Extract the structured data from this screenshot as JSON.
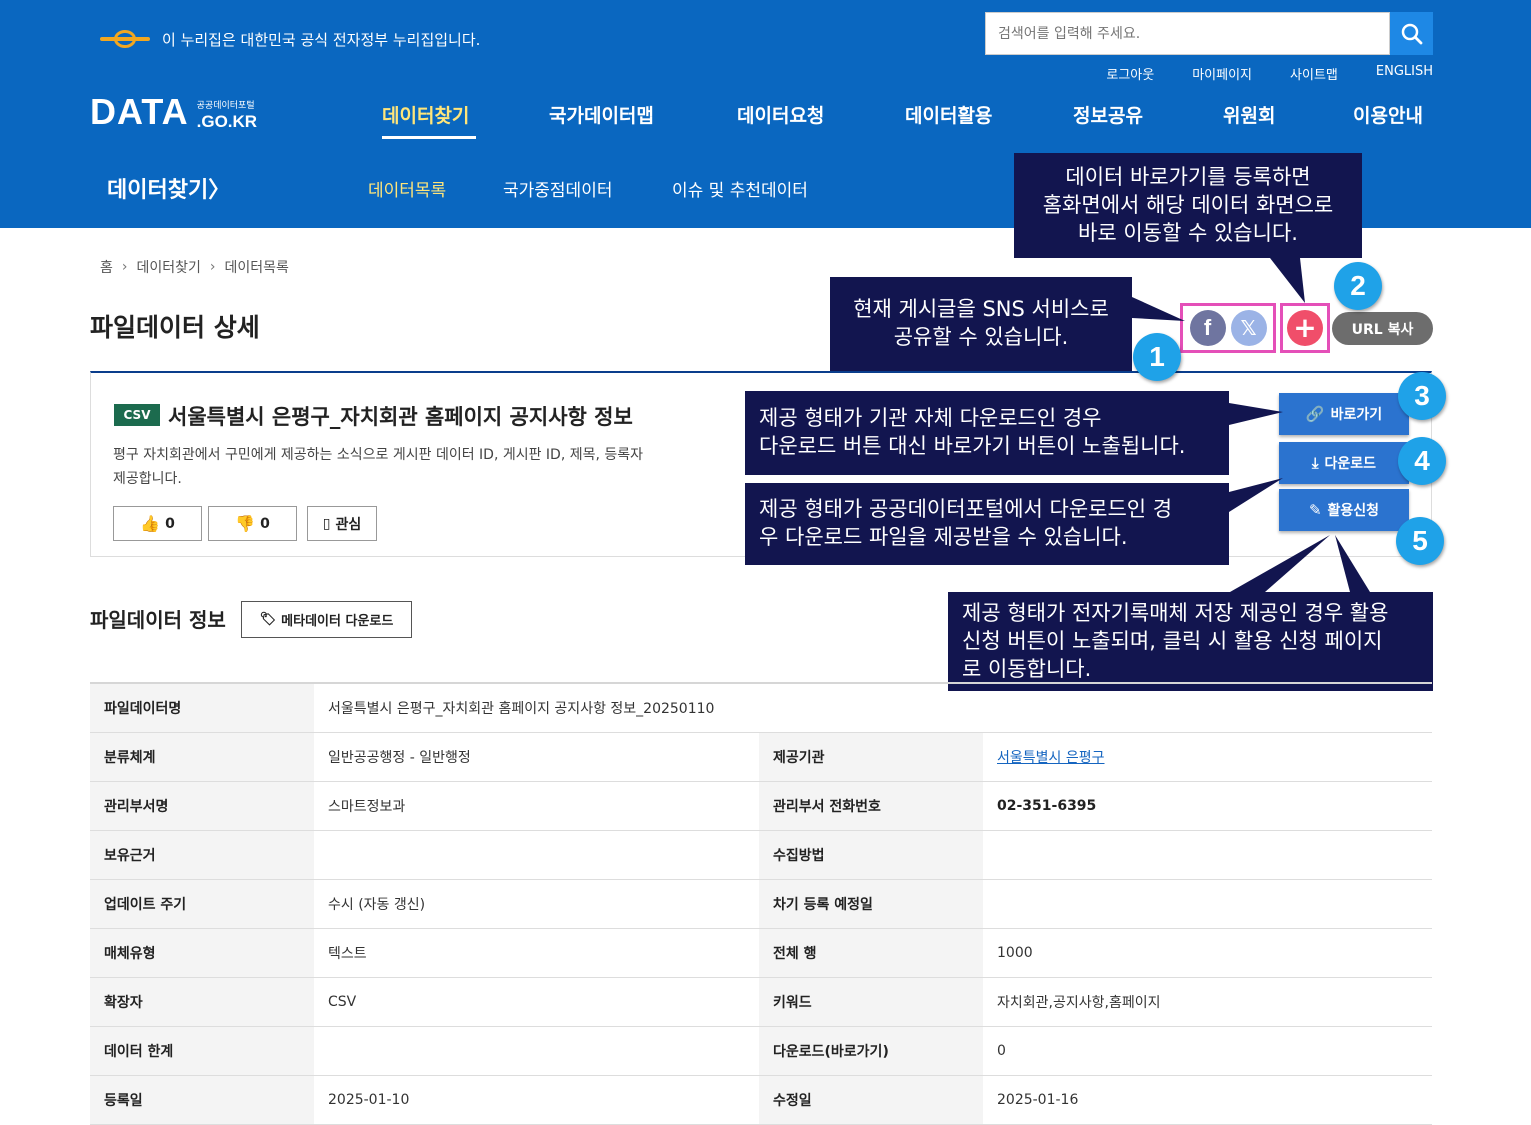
{
  "header": {
    "gov_notice": "이 누리집은 대한민국 공식 전자정부 누리집입니다.",
    "search_placeholder": "검색어를 입력해 주세요.",
    "util_links": [
      "로그아웃",
      "마이페이지",
      "사이트맵",
      "ENGLISH"
    ],
    "logo_main": "DATA",
    "logo_sub_top": "공공데이터포털",
    "logo_sub_bottom": ".GO.KR",
    "gnb": [
      "데이터찾기",
      "국가데이터맵",
      "데이터요청",
      "데이터활용",
      "정보공유",
      "위원회",
      "이용안내"
    ],
    "lnb_title": "데이터찾기〉",
    "lnb": [
      "데이터목록",
      "국가중점데이터",
      "이슈 및 추천데이터"
    ]
  },
  "breadcrumb": [
    "홈",
    "데이터찾기",
    "데이터목록"
  ],
  "page_title": "파일데이터 상세",
  "share": {
    "facebook": "f",
    "x": "𝕏",
    "plus": "+",
    "url_copy": "URL 복사"
  },
  "card": {
    "format_tag": "CSV",
    "title": "서울특별시 은평구_자치회관 홈페이지 공지사항 정보",
    "desc_line1": "평구 자치회관에서 구민에게 제공하는 소식으로 게시판 데이터 ID, 게시판 ID, 제목, 등록자",
    "desc_line2": "제공합니다.",
    "like_count": "0",
    "dislike_count": "0",
    "interest_label": "관심"
  },
  "buttons": {
    "shortcut": "바로가기",
    "download": "다운로드",
    "apply": "활용신청"
  },
  "badges": [
    "1",
    "2",
    "3",
    "4",
    "5"
  ],
  "callouts": {
    "c1": [
      "현재 게시글을 SNS 서비스로",
      "공유할 수 있습니다."
    ],
    "c2": [
      "데이터 바로가기를 등록하면",
      "홈화면에서 해당 데이터 화면으로",
      "바로 이동할 수 있습니다."
    ],
    "c3": [
      "제공 형태가 기관 자체 다운로드인 경우",
      "다운로드 버튼 대신 바로가기 버튼이 노출됩니다."
    ],
    "c4": [
      "제공 형태가 공공데이터포털에서 다운로드인 경",
      "우 다운로드 파일을 제공받을 수 있습니다."
    ],
    "c5": [
      "제공 형태가 전자기록매체 저장 제공인 경우 활용",
      "신청 버튼이 노출되며, 클릭 시 활용 신청 페이지",
      "로 이동합니다."
    ]
  },
  "info_section": {
    "title": "파일데이터 정보",
    "meta_download": "메타데이터 다운로드",
    "rows": [
      {
        "k1": "파일데이터명",
        "v1": "서울특별시 은평구_자치회관 홈페이지 공지사항 정보_20250110"
      },
      {
        "k1": "분류체계",
        "v1": "일반공공행정 - 일반행정",
        "k2": "제공기관",
        "v2": "서울특별시 은평구"
      },
      {
        "k1": "관리부서명",
        "v1": "스마트정보과",
        "k2": "관리부서 전화번호",
        "v2": "02-351-6395"
      },
      {
        "k1": "보유근거",
        "v1": "",
        "k2": "수집방법",
        "v2": ""
      },
      {
        "k1": "업데이트 주기",
        "v1": "수시 (자동 갱신)",
        "k2": "차기 등록 예정일",
        "v2": ""
      },
      {
        "k1": "매체유형",
        "v1": "텍스트",
        "k2": "전체 행",
        "v2": "1000"
      },
      {
        "k1": "확장자",
        "v1": "CSV",
        "k2": "키워드",
        "v2": "자치회관,공지사항,홈페이지"
      },
      {
        "k1": "데이터 한계",
        "v1": "",
        "k2": "다운로드(바로가기)",
        "v2": "0"
      },
      {
        "k1": "등록일",
        "v1": "2025-01-10",
        "k2": "수정일",
        "v2": "2025-01-16"
      }
    ]
  },
  "colors": {
    "header_bg": "#0a67c0",
    "active_menu": "#ffe57a",
    "callout_bg": "#12154f",
    "badge": "#1fa2e8",
    "highlight_border": "#e44fb8",
    "action_button": "#2b73cf"
  }
}
